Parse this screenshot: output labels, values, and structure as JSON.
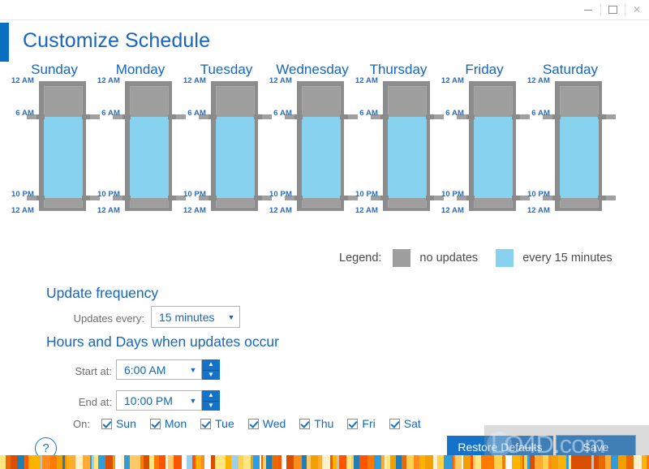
{
  "window": {
    "minimize_label": "–",
    "maximize_label": "□",
    "close_label": "×"
  },
  "header": {
    "title": "Customize Schedule"
  },
  "chart_data": {
    "type": "bar",
    "title": "Customize Schedule",
    "categories": [
      "Sunday",
      "Monday",
      "Tuesday",
      "Wednesday",
      "Thursday",
      "Friday",
      "Saturday"
    ],
    "ylabel": "",
    "xlabel": "",
    "axis_ticks": [
      "12 AM",
      "6 AM",
      "10 PM",
      "12 AM"
    ],
    "ylim": [
      0,
      24
    ],
    "grid": false,
    "legend_position": "bottom-right",
    "series": [
      {
        "name": "no updates",
        "color": "#9e9e9e",
        "values": [
          6,
          6,
          6,
          6,
          6,
          6,
          6
        ]
      },
      {
        "name": "every 15 minutes",
        "color": "#87d3ef",
        "values": [
          16,
          16,
          16,
          16,
          16,
          16,
          16
        ]
      },
      {
        "name": "no updates (end)",
        "color": "#9e9e9e",
        "values": [
          2,
          2,
          2,
          2,
          2,
          2,
          2
        ]
      }
    ],
    "start_hour_label": "6 AM",
    "end_hour_label": "10 PM",
    "day_start_label": "12 AM",
    "day_end_label": "12 AM"
  },
  "days": [
    {
      "name": "Sunday",
      "top": "12 AM",
      "start": "6 AM",
      "end": "10 PM",
      "bottom": "12 AM"
    },
    {
      "name": "Monday",
      "top": "12 AM",
      "start": "6 AM",
      "end": "10 PM",
      "bottom": "12 AM"
    },
    {
      "name": "Tuesday",
      "top": "12 AM",
      "start": "6 AM",
      "end": "10 PM",
      "bottom": "12 AM"
    },
    {
      "name": "Wednesday",
      "top": "12 AM",
      "start": "6 AM",
      "end": "10 PM",
      "bottom": "12 AM"
    },
    {
      "name": "Thursday",
      "top": "12 AM",
      "start": "6 AM",
      "end": "10 PM",
      "bottom": "12 AM"
    },
    {
      "name": "Friday",
      "top": "12 AM",
      "start": "6 AM",
      "end": "10 PM",
      "bottom": "12 AM"
    },
    {
      "name": "Saturday",
      "top": "12 AM",
      "start": "6 AM",
      "end": "10 PM",
      "bottom": "12 AM"
    }
  ],
  "legend": {
    "label": "Legend:",
    "items": [
      {
        "text": "no updates",
        "color": "#9e9e9e"
      },
      {
        "text": "every 15 minutes",
        "color": "#87d3ef"
      }
    ]
  },
  "update_frequency": {
    "heading": "Update frequency",
    "field_label": "Updates every:",
    "value": "15 minutes",
    "caret": "▼"
  },
  "hours_days": {
    "heading": "Hours and Days when updates occur",
    "start": {
      "label": "Start at:",
      "value": "6:00 AM",
      "caret": "▼"
    },
    "end": {
      "label": "End at:",
      "value": "10:00 PM",
      "caret": "▼"
    },
    "spinner_up": "▲",
    "spinner_down": "▼",
    "on_label": "On:",
    "checkboxes": [
      {
        "label": "Sun",
        "checked": true
      },
      {
        "label": "Mon",
        "checked": true
      },
      {
        "label": "Tue",
        "checked": true
      },
      {
        "label": "Wed",
        "checked": true
      },
      {
        "label": "Thu",
        "checked": true
      },
      {
        "label": "Fri",
        "checked": true
      },
      {
        "label": "Sat",
        "checked": true
      }
    ]
  },
  "footer": {
    "help_label": "?",
    "restore_label": "Restore Defaults",
    "save_label": "Save"
  },
  "watermark": {
    "text": "LO4D.com"
  },
  "colors": {
    "accent": "#1472c8",
    "heading": "#1666bd",
    "inactive": "#9e9e9e",
    "active": "#87d3ef"
  }
}
